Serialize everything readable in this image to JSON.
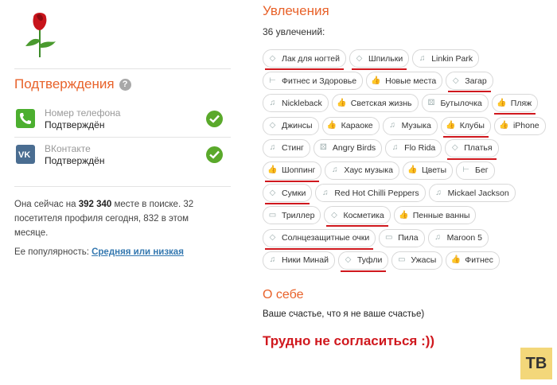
{
  "confirmations": {
    "title": "Подтверждения",
    "help_icon": "?",
    "items": [
      {
        "name": "Номер телефона",
        "status": "Подтверждён",
        "icon": "phone-icon"
      },
      {
        "name": "ВКонтакте",
        "status": "Подтверждён",
        "icon": "vk-icon"
      }
    ]
  },
  "stats": {
    "prefix": "Она сейчас на ",
    "rank": "392 340",
    "suffix": " месте в поиске. 32 посетителя профиля сегодня, 832 в этом месяце."
  },
  "popularity": {
    "label": "Ее популярность: ",
    "value": "Средняя или низкая"
  },
  "interests": {
    "title": "Увлечения",
    "count": "36 увлечений:",
    "rows": [
      [
        {
          "label": "Лак для ногтей",
          "icon": "diamond",
          "u": true
        },
        {
          "label": "Шпильки",
          "icon": "diamond",
          "u": true
        },
        {
          "label": "Linkin Park",
          "icon": "music",
          "u": false
        }
      ],
      [
        {
          "label": "Фитнес и Здоровье",
          "icon": "dumbbell",
          "u": false
        },
        {
          "label": "Новые места",
          "icon": "thumb",
          "u": false
        },
        {
          "label": "Загар",
          "icon": "diamond",
          "u": true
        }
      ],
      [
        {
          "label": "Nickleback",
          "icon": "music",
          "u": false
        },
        {
          "label": "Светская жизнь",
          "icon": "thumb",
          "u": false
        },
        {
          "label": "Бутылочка",
          "icon": "dice",
          "u": false
        },
        {
          "label": "Пляж",
          "icon": "thumb",
          "u": true
        }
      ],
      [
        {
          "label": "Джинсы",
          "icon": "diamond",
          "u": false
        },
        {
          "label": "Караоке",
          "icon": "thumb",
          "u": false
        },
        {
          "label": "Музыка",
          "icon": "music",
          "u": false
        },
        {
          "label": "Клубы",
          "icon": "thumb",
          "u": true
        },
        {
          "label": "iPhone",
          "icon": "thumb",
          "u": false
        }
      ],
      [
        {
          "label": "Стинг",
          "icon": "music",
          "u": false
        },
        {
          "label": "Angry Birds",
          "icon": "dice",
          "u": false
        },
        {
          "label": "Flo Rida",
          "icon": "music",
          "u": false
        },
        {
          "label": "Платья",
          "icon": "diamond",
          "u": true
        }
      ],
      [
        {
          "label": "Шоппинг",
          "icon": "thumb",
          "u": true
        },
        {
          "label": "Хаус музыка",
          "icon": "music",
          "u": false
        },
        {
          "label": "Цветы",
          "icon": "thumb",
          "u": false
        },
        {
          "label": "Бег",
          "icon": "dumbbell",
          "u": false
        }
      ],
      [
        {
          "label": "Сумки",
          "icon": "diamond",
          "u": true
        },
        {
          "label": "Red Hot Chilli Peppers",
          "icon": "music",
          "u": false
        },
        {
          "label": "Mickael Jackson",
          "icon": "music",
          "u": false
        }
      ],
      [
        {
          "label": "Триллер",
          "icon": "monitor",
          "u": false
        },
        {
          "label": "Косметика",
          "icon": "diamond",
          "u": true
        },
        {
          "label": "Пенные ванны",
          "icon": "thumb",
          "u": false
        }
      ],
      [
        {
          "label": "Солнцезащитные очки",
          "icon": "diamond",
          "u": true
        },
        {
          "label": "Пила",
          "icon": "monitor",
          "u": false
        },
        {
          "label": "Maroon 5",
          "icon": "music",
          "u": false
        }
      ],
      [
        {
          "label": "Ники Минай",
          "icon": "music",
          "u": false
        },
        {
          "label": "Туфли",
          "icon": "diamond",
          "u": true
        },
        {
          "label": "Ужасы",
          "icon": "monitor",
          "u": false
        },
        {
          "label": "Фитнес",
          "icon": "thumb",
          "u": false
        }
      ]
    ]
  },
  "about": {
    "title": "О себе",
    "text": "Ваше счастье, что я не ваше счастье)"
  },
  "caption": "Трудно не согласиться :))",
  "badge": "ТВ",
  "colors": {
    "accent": "#e8622a",
    "underline": "#d0181e",
    "check": "#5aa92b",
    "phone": "#4caf2f",
    "vk": "#4a6d91",
    "badge_bg": "#f3d77a"
  }
}
